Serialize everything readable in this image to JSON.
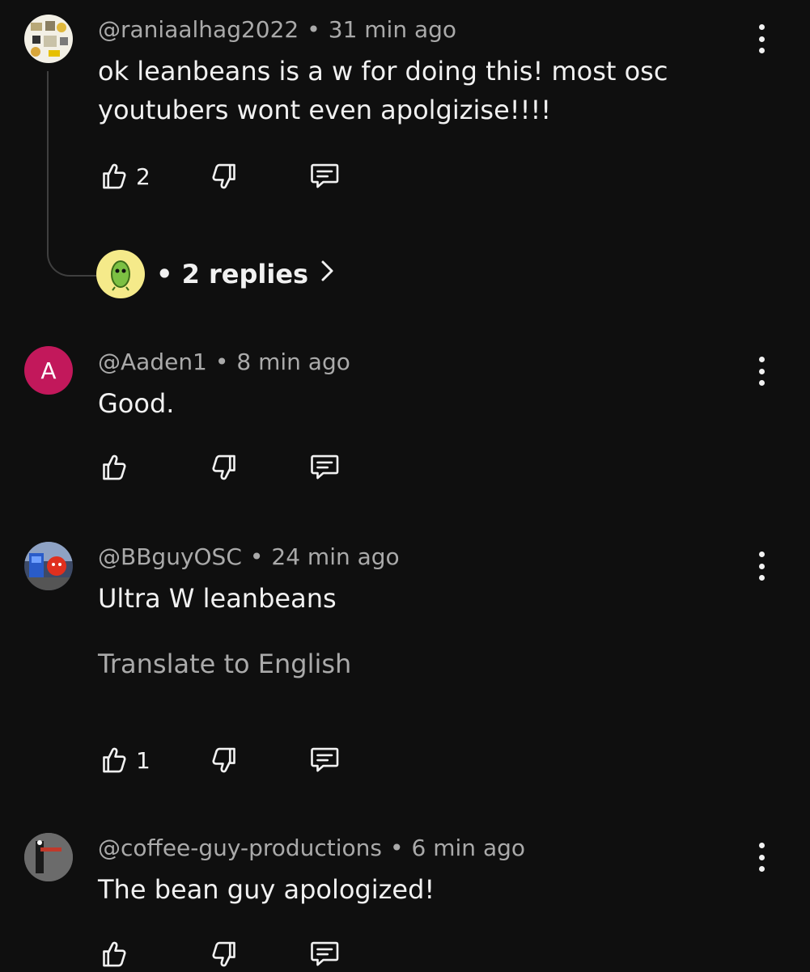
{
  "comments": [
    {
      "handle": "@raniaalhag2022",
      "time": "31 min ago",
      "text_lines": [
        "ok leanbeans is a w for doing this! most osc",
        "youtubers wont even apolgizise!!!!"
      ],
      "likes": "2",
      "avatar_icon": "collage-avatar",
      "replies": {
        "label": "2 replies",
        "avatar_icon": "green-bean-avatar"
      }
    },
    {
      "handle": "@Aaden1",
      "time": "8 min ago",
      "text_lines": [
        "Good."
      ],
      "likes": "",
      "avatar_letter": "A",
      "avatar_color": "#c2185b"
    },
    {
      "handle": "@BBguyOSC",
      "time": "24 min ago",
      "text_lines": [
        "Ultra W leanbeans"
      ],
      "translate": "Translate to English",
      "likes": "1",
      "avatar_icon": "cartoon-characters-avatar"
    },
    {
      "handle": "@coffee-guy-productions",
      "time": "6 min ago",
      "text_lines": [
        "The bean guy apologized!"
      ],
      "likes": "",
      "avatar_icon": "coffee-character-avatar"
    }
  ],
  "icons": {
    "like": "thumbs-up-icon",
    "dislike": "thumbs-down-icon",
    "reply": "comment-icon",
    "menu": "more-vertical-icon",
    "expand": "chevron-right-icon"
  },
  "colors": {
    "background": "#0f0f0f",
    "text": "#f1f1f1",
    "secondary_text": "#aaaaaa"
  }
}
